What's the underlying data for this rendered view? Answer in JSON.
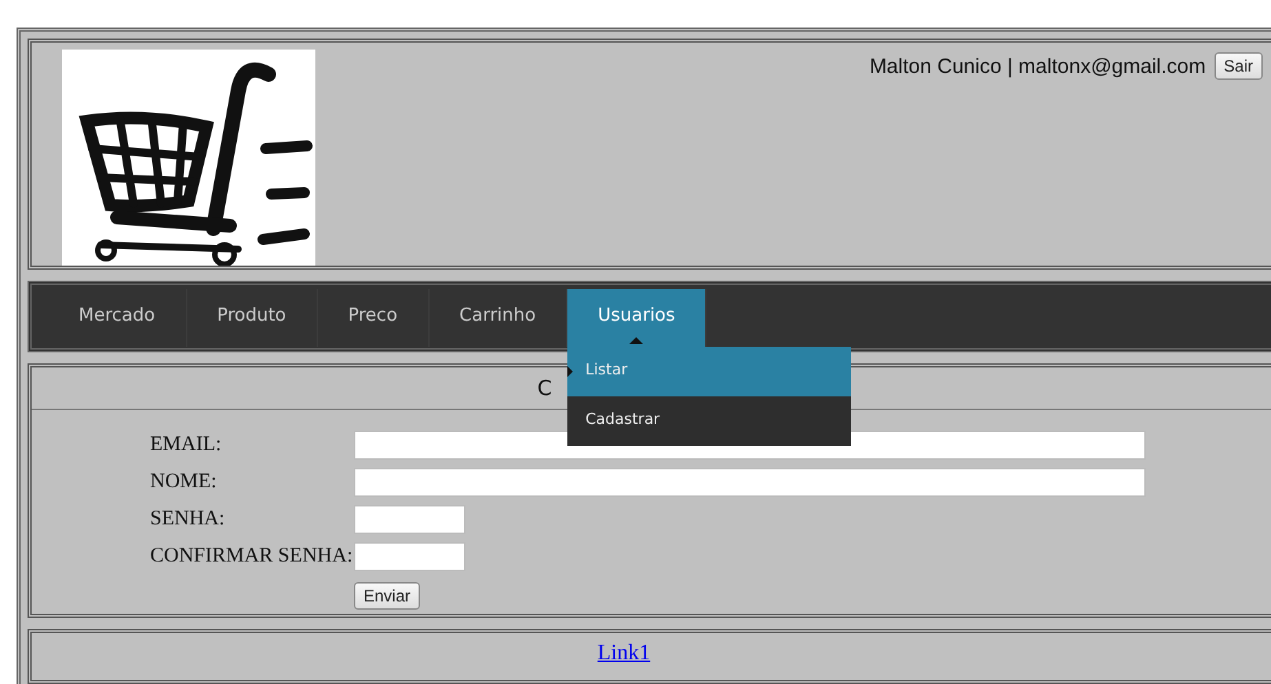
{
  "header": {
    "user": "Malton Cunico | maltonx@gmail.com",
    "logout_button": "Sair"
  },
  "nav": {
    "tabs": [
      {
        "label": "Mercado",
        "selected": false
      },
      {
        "label": "Produto",
        "selected": false
      },
      {
        "label": "Preco",
        "selected": false
      },
      {
        "label": "Carrinho",
        "selected": false
      },
      {
        "label": "Usuarios",
        "selected": true
      }
    ],
    "dropdown": [
      {
        "label": "Listar",
        "selected": true
      },
      {
        "label": "Cadastrar",
        "selected": false
      }
    ]
  },
  "form": {
    "title": "C",
    "fields": [
      {
        "label": "EMAIL:",
        "kind": "wide"
      },
      {
        "label": "NOME:",
        "kind": "wide"
      },
      {
        "label": "SENHA:",
        "kind": "short"
      },
      {
        "label": "CONFIRMAR SENHA:",
        "kind": "short"
      }
    ],
    "submit": "Enviar"
  },
  "footer": {
    "link": "Link1"
  }
}
